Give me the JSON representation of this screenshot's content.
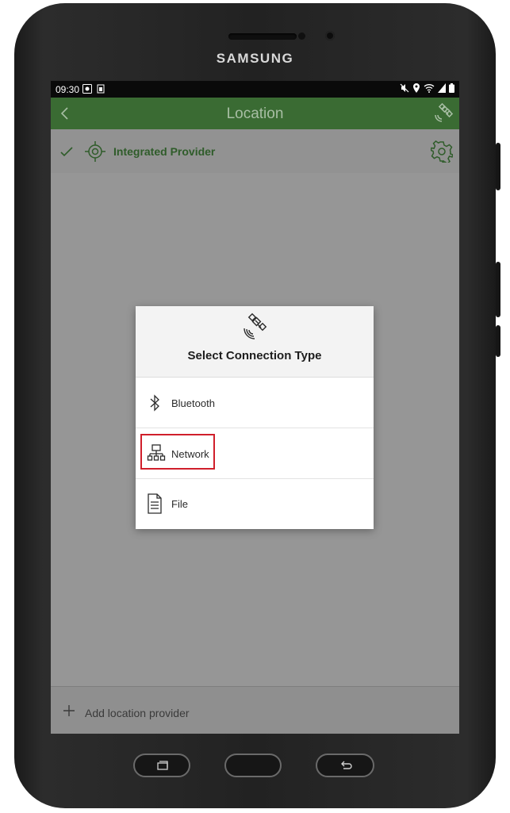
{
  "device": {
    "brand": "SAMSUNG"
  },
  "status_bar": {
    "time": "09:30"
  },
  "app_bar": {
    "title": "Location"
  },
  "provider": {
    "label": "Integrated Provider"
  },
  "dialog": {
    "title": "Select Connection Type",
    "options": [
      {
        "label": "Bluetooth",
        "icon": "bluetooth-icon"
      },
      {
        "label": "Network",
        "icon": "network-icon",
        "highlighted": true
      },
      {
        "label": "File",
        "icon": "file-icon"
      }
    ]
  },
  "footer": {
    "add_label": "Add location provider"
  },
  "colors": {
    "app_bar": "#3a6b33",
    "accent_green": "#2f5c2a",
    "highlight_red": "#d01f2b"
  }
}
